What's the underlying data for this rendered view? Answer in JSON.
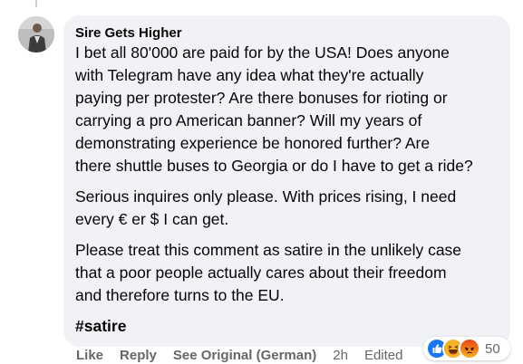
{
  "comment": {
    "author": "Sire Gets Higher",
    "paragraphs": [
      "I bet all 80'000 are paid for by the USA! Does anyone\nwith Telegram have any idea what they're actually\npaying per protester? Are there bonuses for rioting or\ncarrying a pro American banner? Will my years of\ndemonstrating experience be honored further? Are\nthere shuttle buses to Georgia or do I have to get a ride?",
      "Serious inquires only please. With prices rising, I need\nevery € er $ I can get.",
      "Please treat this comment as satire in the unlikely case\nthat a poor people actually cares about their freedom\nand therefore turns to the EU."
    ],
    "hashtag": "#satire"
  },
  "actions": {
    "like": "Like",
    "reply": "Reply",
    "see_original": "See Original (German)",
    "time": "2h",
    "edited": "Edited"
  },
  "reactions": {
    "icons": [
      "like-icon",
      "haha-icon",
      "angry-icon"
    ],
    "count": "50",
    "colors": {
      "like": "#1877f2",
      "haha": "#f7b125",
      "angry": "#e9710f"
    }
  }
}
